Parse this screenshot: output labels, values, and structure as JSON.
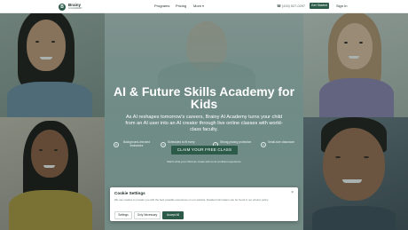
{
  "nav": {
    "logo_mark": "B",
    "logo_name": "Brainy",
    "logo_sub": "AI ACADEMY",
    "links": [
      "Programs",
      "Pricing",
      "More"
    ],
    "phone": "(415) 527-0297",
    "get_started": "Get Started",
    "sign_in": "Sign In",
    "icons": {
      "more": "chevron-down-icon",
      "phone": "phone-icon"
    }
  },
  "hero": {
    "title": "AI & Future Skills Academy for Kids",
    "subtitle": "As AI reshapes tomorrow's careers, Brainy AI Academy turns your child from an AI user into an AI creator through live online classes with world-class faculty.",
    "features": [
      {
        "icon": "graduation-cap-icon",
        "text": "Background-checked instructors"
      },
      {
        "icon": "clock-icon",
        "text": "Scheduled to fit every"
      },
      {
        "icon": "shield-icon",
        "text": "Strong privacy protection"
      },
      {
        "icon": "users-icon",
        "text": "Small-size classroom"
      }
    ],
    "cta": "CLAIM YOUR FREE CLASS",
    "cta_note": "Watch what your child can create with an AI-confident experience"
  },
  "cookie": {
    "title": "Cookie Settings",
    "text": "We use cookies to provide you with the best possible experience on our website. Detailed information can be found in our privacy policy.",
    "buttons": [
      "Settings",
      "Only Necessary",
      "Accept All"
    ]
  },
  "colors": {
    "brand": "#2c5b4a",
    "overlay": "#1e322d"
  }
}
